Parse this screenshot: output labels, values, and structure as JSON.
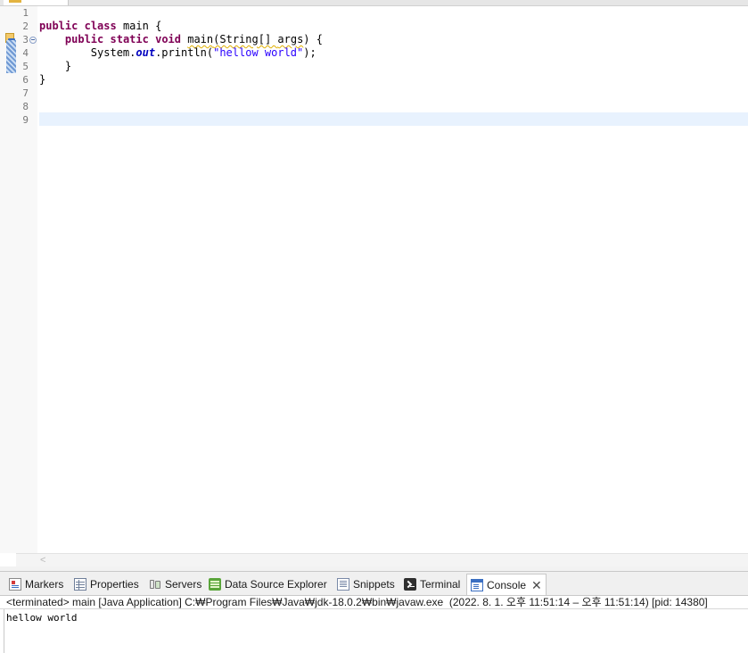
{
  "editor": {
    "line_numbers": [
      "1",
      "2",
      "3",
      "4",
      "5",
      "6",
      "7",
      "8",
      "9"
    ],
    "code": {
      "line2_kw1": "public",
      "line2_kw2": "class",
      "line2_rest": " main {",
      "line3_indent": "    ",
      "line3_kw1": "public",
      "line3_kw2": "static",
      "line3_kw3": "void",
      "line3_method": "main",
      "line3_params_a": "(String[] ",
      "line3_params_b": "args",
      "line3_rest": ") {",
      "line4_a": "        System.",
      "line4_field": "out",
      "line4_b": ".println(",
      "line4_str": "\"hellow world\"",
      "line4_end": ");",
      "line5": "    }",
      "line6": "}"
    },
    "colors": {
      "keyword": "#7f0055",
      "string": "#2a00ff",
      "static_field": "#0000c0",
      "current_line": "#e8f2fe"
    }
  },
  "panel": {
    "tabs": [
      {
        "label": "Markers",
        "icon": "markers-icon"
      },
      {
        "label": "Properties",
        "icon": "properties-icon"
      },
      {
        "label": "Servers",
        "icon": "servers-icon"
      },
      {
        "label": "Data Source Explorer",
        "icon": "data-source-explorer-icon"
      },
      {
        "label": "Snippets",
        "icon": "snippets-icon"
      },
      {
        "label": "Terminal",
        "icon": "terminal-icon"
      },
      {
        "label": "Console",
        "icon": "console-icon",
        "active": true
      }
    ],
    "console": {
      "header": "<terminated> main [Java Application] C:₩Program Files₩Java₩jdk-18.0.2₩bin₩javaw.exe  (2022. 8. 1. 오후 11:51:14 – 오후 11:51:14) [pid: 14380]",
      "output": "hellow world"
    }
  }
}
